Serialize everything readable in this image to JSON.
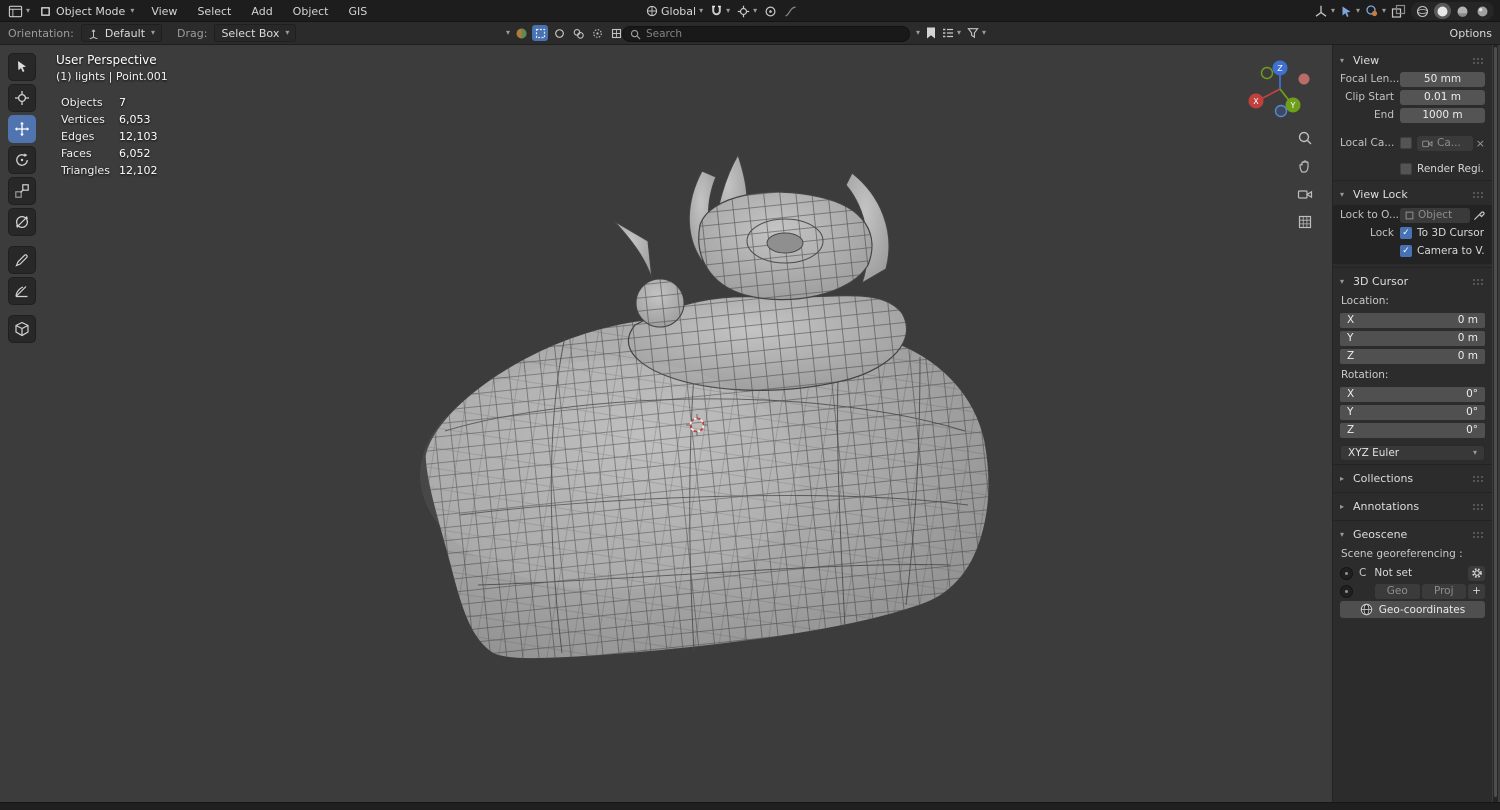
{
  "topbar": {
    "mode_label": "Object Mode",
    "menus": [
      {
        "label": "View"
      },
      {
        "label": "Select"
      },
      {
        "label": "Add"
      },
      {
        "label": "Object"
      },
      {
        "label": "GIS"
      }
    ],
    "orientation_value": "Global"
  },
  "viewport_header": {
    "orientation_label": "Orientation:",
    "orientation_value": "Default",
    "drag_label": "Drag:",
    "drag_value": "Select Box",
    "search_placeholder": "Search",
    "options_label": "Options"
  },
  "viewport": {
    "overlay": {
      "title": "User Perspective",
      "subtitle": "(1) lights | Point.001",
      "stats": [
        {
          "label": "Objects",
          "value": "7"
        },
        {
          "label": "Vertices",
          "value": "6,053"
        },
        {
          "label": "Edges",
          "value": "12,103"
        },
        {
          "label": "Faces",
          "value": "6,052"
        },
        {
          "label": "Triangles",
          "value": "12,102"
        }
      ]
    },
    "gizmo_axes": [
      "X",
      "Y",
      "Z"
    ]
  },
  "sidebar": {
    "view": {
      "title": "View",
      "focal_label": "Focal Len...",
      "focal_value": "50 mm",
      "clip_start_label": "Clip Start",
      "clip_start_value": "0.01 m",
      "clip_end_label": "End",
      "clip_end_value": "1000 m",
      "local_camera_label": "Local Ca...",
      "local_camera_value": "Ca...",
      "render_region_label": "Render Regi..."
    },
    "view_lock": {
      "title": "View Lock",
      "lock_to_label": "Lock to O...",
      "lock_to_value": "Object",
      "lock_label": "Lock",
      "to_3d_cursor_label": "To 3D Cursor",
      "camera_to_view_label": "Camera to V..."
    },
    "cursor_3d": {
      "title": "3D Cursor",
      "location_label": "Location:",
      "location": [
        {
          "axis": "X",
          "value": "0 m"
        },
        {
          "axis": "Y",
          "value": "0 m"
        },
        {
          "axis": "Z",
          "value": "0 m"
        }
      ],
      "rotation_label": "Rotation:",
      "rotation": [
        {
          "axis": "X",
          "value": "0°"
        },
        {
          "axis": "Y",
          "value": "0°"
        },
        {
          "axis": "Z",
          "value": "0°"
        }
      ],
      "rotation_mode": "XYZ Euler"
    },
    "collections_title": "Collections",
    "annotations_title": "Annotations",
    "geoscene": {
      "title": "Geoscene",
      "subtitle": "Scene georeferencing :",
      "crs_prefix": "C",
      "crs_value": "Not set",
      "geo_label": "Geo",
      "proj_label": "Proj",
      "add_label": "+",
      "geocoords_label": "Geo-coordinates"
    }
  },
  "icons": {
    "search-icon": "magnifier",
    "bookmark-icon": "bookmark",
    "filter-icon": "funnel",
    "list-icon": "list",
    "magnet-icon": "magnet",
    "gear-icon": "gear",
    "eyedropper-icon": "eyedropper",
    "camera-icon": "camera",
    "object-icon": "cube",
    "globe-icon": "globe",
    "zoom-icon": "magnifier",
    "pan-icon": "hand",
    "toggle-camera-icon": "camera",
    "ortho-grid-icon": "grid"
  },
  "colors": {
    "accent": "#4772b3",
    "axis_x": "#c2403c",
    "axis_y": "#6f9f1a",
    "axis_z": "#3f6fd0",
    "viewport_bg": "#3c3c3c"
  }
}
